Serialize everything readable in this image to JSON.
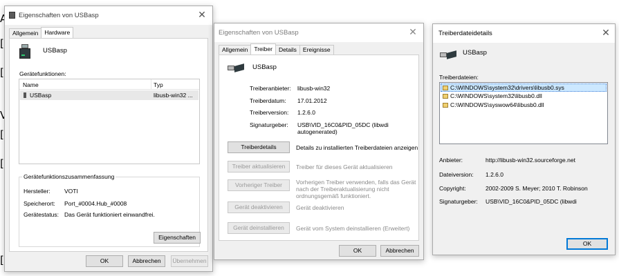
{
  "background": {
    "fragments": [
      "A",
      "[",
      "[",
      "V",
      "[",
      "[",
      "["
    ]
  },
  "window1": {
    "title": "Eigenschaften von USBasp",
    "tabs": [
      "Allgemein",
      "Hardware"
    ],
    "active_tab": "Hardware",
    "device_name": "USBasp",
    "functions_label": "Gerätefunktionen:",
    "columns": [
      "Name",
      "Typ"
    ],
    "rows": [
      {
        "name": "USBasp",
        "type": "libusb-win32 ..."
      }
    ],
    "summary_title": "Gerätefunktionszusammenfassung",
    "manufacturer_label": "Hersteller:",
    "manufacturer_value": "VOTI",
    "location_label": "Speicherort:",
    "location_value": "Port_#0004.Hub_#0008",
    "status_label": "Gerätestatus:",
    "status_value": "Das Gerät funktioniert einwandfrei.",
    "properties_button": "Eigenschaften",
    "ok": "OK",
    "cancel": "Abbrechen",
    "apply": "Übernehmen"
  },
  "window2": {
    "title": "Eigenschaften von USBasp",
    "tabs": [
      "Allgemein",
      "Treiber",
      "Details",
      "Ereignisse"
    ],
    "active_tab": "Treiber",
    "device_name": "USBasp",
    "provider_label": "Treiberanbieter:",
    "provider_value": "libusb-win32",
    "date_label": "Treiberdatum:",
    "date_value": "17.01.2012",
    "version_label": "Treiberversion:",
    "version_value": "1.2.6.0",
    "signer_label": "Signaturgeber:",
    "signer_value_line1": "USB\\VID_16C0&PID_05DC (libwdi",
    "signer_value_line2": "autogenerated)",
    "buttons": [
      {
        "label": "Treiberdetails",
        "desc": "Details zu installierten Treiberdateien anzeigen",
        "enabled": true
      },
      {
        "label": "Treiber aktualisieren",
        "desc": "Treiber für dieses Gerät aktualisieren",
        "enabled": false
      },
      {
        "label": "Vorheriger Treiber",
        "desc_line1": "Vorherigen Treiber verwenden, falls das Gerät",
        "desc_line2": "nach der Treiberaktualisierung nicht",
        "desc_line3": "ordnungsgemäß funktioniert.",
        "enabled": false
      },
      {
        "label": "Gerät deaktivieren",
        "desc": "Gerät deaktivieren",
        "enabled": false
      },
      {
        "label": "Gerät deinstallieren",
        "desc": "Gerät vom System deinstallieren (Erweitert)",
        "enabled": false
      }
    ],
    "ok": "OK",
    "cancel": "Abbrechen"
  },
  "window3": {
    "title": "Treiberdateidetails",
    "device_name": "USBasp",
    "files_label": "Treiberdateien:",
    "files": [
      "C:\\WINDOWS\\system32\\drivers\\libusb0.sys",
      "C:\\WINDOWS\\system32\\libusb0.dll",
      "C:\\WINDOWS\\syswow64\\libusb0.dll"
    ],
    "provider_label": "Anbieter:",
    "provider_value": "http://libusb-win32.sourceforge.net",
    "fileversion_label": "Dateiversion:",
    "fileversion_value": "1.2.6.0",
    "copyright_label": "Copyright:",
    "copyright_value": "2002-2009 S. Meyer; 2010 T. Robinson",
    "signer_label": "Signaturgeber:",
    "signer_value": "USB\\VID_16C0&PID_05DC (libwdi",
    "ok": "OK"
  }
}
